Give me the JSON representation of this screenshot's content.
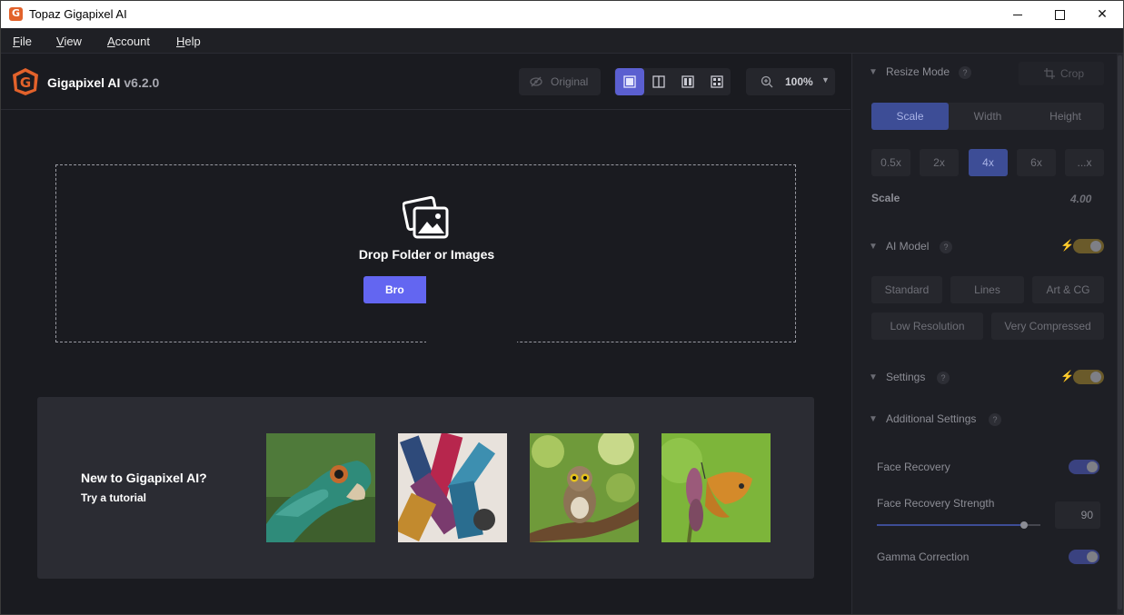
{
  "window": {
    "title": "Topaz Gigapixel AI",
    "controls": {
      "minimize": "",
      "maximize": "",
      "close": "✕"
    }
  },
  "menu": [
    {
      "underline": "F",
      "rest": "ile"
    },
    {
      "underline": "V",
      "rest": "iew"
    },
    {
      "underline": "A",
      "rest": "ccount"
    },
    {
      "underline": "H",
      "rest": "elp"
    }
  ],
  "header": {
    "brand_name": "Gigapixel AI",
    "version": "v6.2.0",
    "original_label": "Original",
    "zoom_value": "100%"
  },
  "dropzone": {
    "title": "Drop Folder or Images",
    "browse_label": "Bro"
  },
  "tutorial": {
    "title": "New to Gigapixel AI?",
    "subtitle": "Try a tutorial",
    "thumbnails": [
      "lizard",
      "paintbrushes",
      "owl",
      "butterfly"
    ]
  },
  "right_panel": {
    "resize_mode": {
      "title": "Resize Mode",
      "help": "?",
      "crop_label": "Crop",
      "tabs": [
        "Scale",
        "Width",
        "Height"
      ],
      "active_tab": "Scale",
      "scale_options": [
        "0.5x",
        "2x",
        "4x",
        "6x",
        "...x"
      ],
      "active_scale": "4x",
      "scale_label": "Scale",
      "scale_value": "4.00"
    },
    "ai_model": {
      "title": "AI Model",
      "help": "?",
      "models_row1": [
        "Standard",
        "Lines",
        "Art & CG"
      ],
      "models_row2": [
        "Low Resolution",
        "Very Compressed"
      ]
    },
    "settings": {
      "title": "Settings",
      "help": "?"
    },
    "additional": {
      "title": "Additional Settings",
      "help": "?",
      "face_recovery": "Face Recovery",
      "face_recovery_strength": "Face Recovery Strength",
      "strength_value": "90",
      "strength_fraction": 0.9,
      "gamma_correction": "Gamma Correction"
    }
  },
  "colors": {
    "accent": "#6366f1",
    "active_tab": "#3d4d96",
    "logo_orange": "#e2622b"
  }
}
